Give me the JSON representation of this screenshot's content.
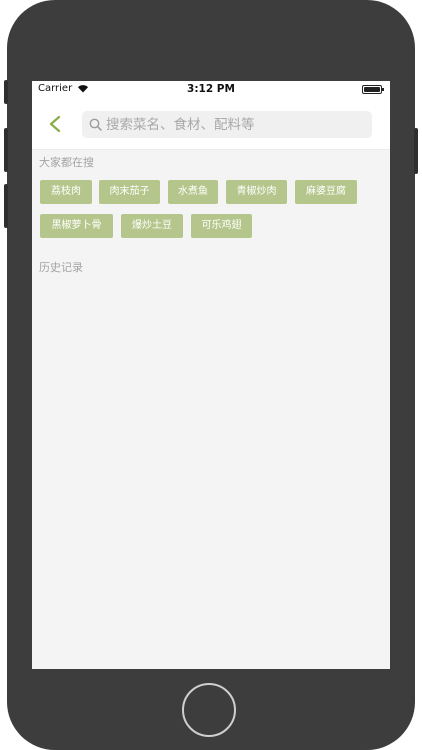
{
  "status_bar": {
    "carrier": "Carrier",
    "time": "3:12 PM"
  },
  "navbar": {
    "back_icon": "chevron-left-icon",
    "search": {
      "icon": "search-icon",
      "placeholder": "搜索菜名、食材、配料等",
      "value": ""
    }
  },
  "popular": {
    "title": "大家都在搜",
    "tags": [
      "荔枝肉",
      "肉末茄子",
      "水煮鱼",
      "青椒炒肉",
      "麻婆豆腐",
      "黑椒萝卜骨",
      "爆炒土豆",
      "可乐鸡翅"
    ]
  },
  "history": {
    "title": "历史记录"
  },
  "colors": {
    "accent": "#8cab45",
    "tag_background": "#b4c68b",
    "page_background": "#f4f4f4",
    "device_frame": "#3d3d3d"
  }
}
